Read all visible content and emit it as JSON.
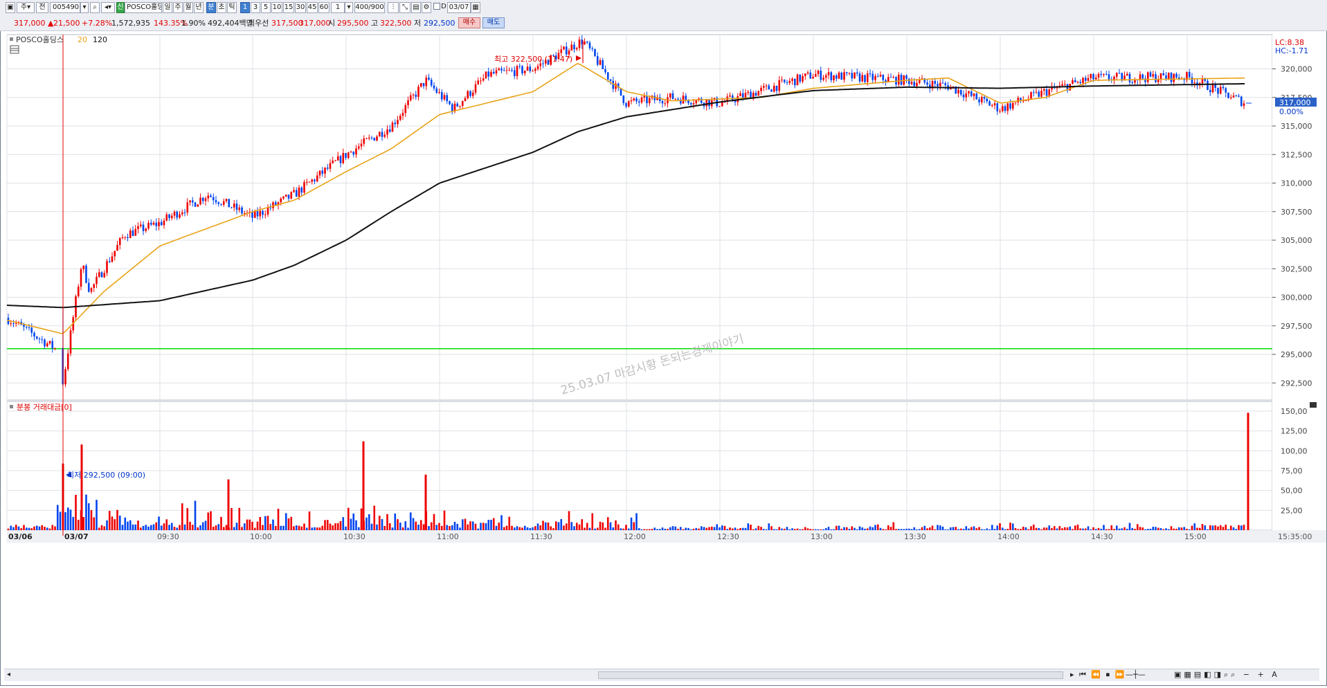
{
  "toolbar": {
    "market_select": "주",
    "segment_label": "전",
    "code": "005490",
    "name": "POSCO홀딩스",
    "period_tabs": [
      "일",
      "주",
      "월",
      "년"
    ],
    "unit_tabs": [
      "분",
      "초",
      "틱"
    ],
    "interval_tabs": [
      "1",
      "3",
      "5",
      "10",
      "15",
      "30",
      "45",
      "60"
    ],
    "interval_value": "1",
    "count_display": "400/900",
    "checkbox_label": "D",
    "date": "03/07"
  },
  "quote": {
    "price": "317,000",
    "change": "21,500",
    "change_pct": "+7.28%",
    "volume": "1,572,935",
    "volume_ratio": "143.35%",
    "turnover_pct": "1.90%",
    "amount": "492,404백만",
    "best_label": "최우선",
    "best_ask": "317,500",
    "best_bid": "317,000",
    "open_label": "시",
    "open": "295,500",
    "high_label": "고",
    "high": "322,500",
    "low_label": "저",
    "low": "292,500",
    "buy_label": "매수",
    "sell_label": "매도"
  },
  "legend": {
    "name": "POSCO홀딩스",
    "ma_short": "20",
    "ma_long": "120"
  },
  "axis_badges": {
    "lc": "LC:8.38",
    "hc": "HC:-1.71",
    "current": "317,000",
    "current_pct": "0.00%"
  },
  "annotations": {
    "high": "최고 322,500 (11:47)",
    "low": "최저 292,500 (09:00)"
  },
  "watermark": "25.03.07 마감시황 돈되는경제이야기",
  "volume_panel_title": "분봉 거래대금[0]",
  "time_labels": [
    "03/06",
    "03/07",
    "09:30",
    "10:00",
    "10:30",
    "11:00",
    "11:30",
    "12:00",
    "12:30",
    "13:00",
    "13:30",
    "14:00",
    "14:30",
    "15:00",
    "15:35:00"
  ],
  "colors": {
    "up": "#ee0000",
    "down": "#0044ee",
    "ma_short": "#e8a317",
    "ma_long": "#111111",
    "support": "#00dd00",
    "grid": "#dde0e6"
  },
  "chart_data": {
    "type": "candlestick",
    "interval": "1 minute",
    "ylim": [
      291000,
      323000
    ],
    "yticks": [
      "292,500",
      "295,000",
      "297,500",
      "300,000",
      "302,500",
      "305,000",
      "307,500",
      "310,000",
      "312,500",
      "315,000",
      "317,500",
      "320,000"
    ],
    "support_line": 295500,
    "high": {
      "value": 322500,
      "time": "11:47"
    },
    "low": {
      "value": 292500,
      "time": "09:00"
    },
    "last": 317000,
    "price_path": [
      {
        "t": "03/06",
        "v": 298200
      },
      {
        "t": "03/06 end",
        "v": 295500
      },
      {
        "t": "09:00",
        "v": 292500
      },
      {
        "t": "09:05",
        "v": 303000
      },
      {
        "t": "09:10",
        "v": 300500
      },
      {
        "t": "09:20",
        "v": 305500
      },
      {
        "t": "09:30",
        "v": 306500
      },
      {
        "t": "09:45",
        "v": 309000
      },
      {
        "t": "10:00",
        "v": 307000
      },
      {
        "t": "10:15",
        "v": 309000
      },
      {
        "t": "10:30",
        "v": 312500
      },
      {
        "t": "10:45",
        "v": 315000
      },
      {
        "t": "10:55",
        "v": 319000
      },
      {
        "t": "11:05",
        "v": 316500
      },
      {
        "t": "11:15",
        "v": 319500
      },
      {
        "t": "11:30",
        "v": 320000
      },
      {
        "t": "11:47",
        "v": 322500
      },
      {
        "t": "12:00",
        "v": 317000
      },
      {
        "t": "12:15",
        "v": 317500
      },
      {
        "t": "12:30",
        "v": 317000
      },
      {
        "t": "13:00",
        "v": 319500
      },
      {
        "t": "13:30",
        "v": 319000
      },
      {
        "t": "13:45",
        "v": 318500
      },
      {
        "t": "14:00",
        "v": 316500
      },
      {
        "t": "14:15",
        "v": 318000
      },
      {
        "t": "14:30",
        "v": 319200
      },
      {
        "t": "15:00",
        "v": 319300
      },
      {
        "t": "15:20",
        "v": 317000
      }
    ],
    "ma20_path": [
      {
        "t": "03/06",
        "v": 298000
      },
      {
        "t": "09:00",
        "v": 296800
      },
      {
        "t": "09:15",
        "v": 300500
      },
      {
        "t": "09:30",
        "v": 304500
      },
      {
        "t": "10:00",
        "v": 307500
      },
      {
        "t": "10:15",
        "v": 308500
      },
      {
        "t": "10:30",
        "v": 311000
      },
      {
        "t": "10:45",
        "v": 313000
      },
      {
        "t": "11:00",
        "v": 316000
      },
      {
        "t": "11:30",
        "v": 318000
      },
      {
        "t": "11:45",
        "v": 320500
      },
      {
        "t": "12:00",
        "v": 318000
      },
      {
        "t": "12:15",
        "v": 317200
      },
      {
        "t": "12:45",
        "v": 317500
      },
      {
        "t": "13:00",
        "v": 318300
      },
      {
        "t": "13:30",
        "v": 319000
      },
      {
        "t": "13:45",
        "v": 319200
      },
      {
        "t": "14:00",
        "v": 317000
      },
      {
        "t": "14:15",
        "v": 317500
      },
      {
        "t": "14:30",
        "v": 319000
      },
      {
        "t": "15:20",
        "v": 319200
      }
    ],
    "ma120_path": [
      {
        "t": "03/06",
        "v": 299300
      },
      {
        "t": "09:00",
        "v": 299100
      },
      {
        "t": "09:30",
        "v": 299700
      },
      {
        "t": "10:00",
        "v": 301500
      },
      {
        "t": "10:15",
        "v": 302800
      },
      {
        "t": "10:30",
        "v": 305000
      },
      {
        "t": "10:45",
        "v": 307500
      },
      {
        "t": "11:00",
        "v": 310000
      },
      {
        "t": "11:30",
        "v": 312700
      },
      {
        "t": "11:45",
        "v": 314500
      },
      {
        "t": "12:00",
        "v": 315800
      },
      {
        "t": "12:30",
        "v": 317100
      },
      {
        "t": "13:00",
        "v": 318100
      },
      {
        "t": "13:30",
        "v": 318400
      },
      {
        "t": "14:00",
        "v": 318300
      },
      {
        "t": "14:30",
        "v": 318500
      },
      {
        "t": "15:20",
        "v": 318700
      }
    ],
    "volume_panel": {
      "title": "분봉 거래대금[0]",
      "ylim": [
        0,
        150
      ],
      "yticks": [
        "25,00",
        "50,00",
        "75,00",
        "100,00",
        "125,00",
        "150,00"
      ],
      "spikes": [
        {
          "t": "09:00",
          "v": 84
        },
        {
          "t": "09:05",
          "v": 108
        },
        {
          "t": "10:35",
          "v": 112
        },
        {
          "t": "10:55",
          "v": 70
        },
        {
          "t": "09:55",
          "v": 64
        },
        {
          "t": "15:35",
          "v": 148
        }
      ]
    }
  }
}
